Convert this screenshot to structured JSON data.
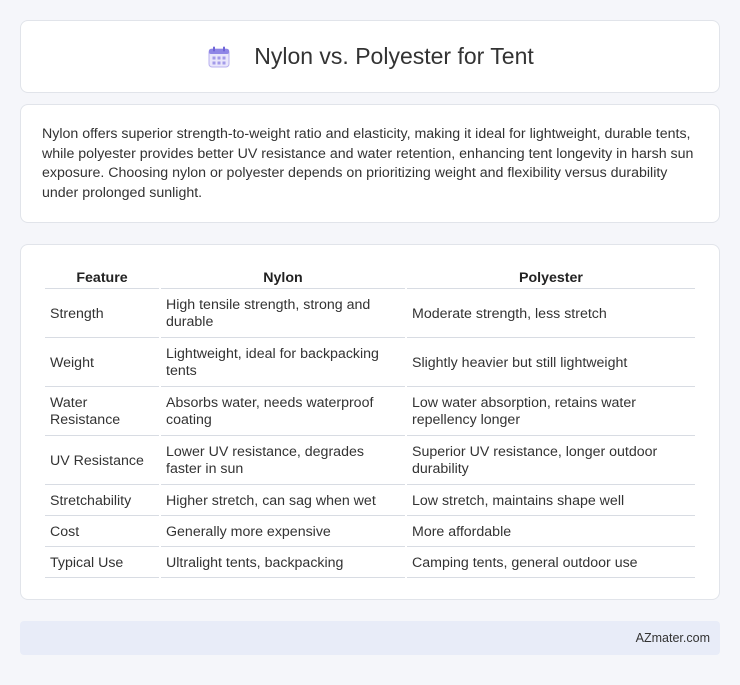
{
  "header": {
    "title": "Nylon vs. Polyester for Tent",
    "icon": "calendar-icon"
  },
  "summary": "Nylon offers superior strength-to-weight ratio and elasticity, making it ideal for lightweight, durable tents, while polyester provides better UV resistance and water retention, enhancing tent longevity in harsh sun exposure. Choosing nylon or polyester depends on prioritizing weight and flexibility versus durability under prolonged sunlight.",
  "table": {
    "headers": [
      "Feature",
      "Nylon",
      "Polyester"
    ],
    "rows": [
      [
        "Strength",
        "High tensile strength, strong and durable",
        "Moderate strength, less stretch"
      ],
      [
        "Weight",
        "Lightweight, ideal for backpacking tents",
        "Slightly heavier but still lightweight"
      ],
      [
        "Water Resistance",
        "Absorbs water, needs waterproof coating",
        "Low water absorption, retains water repellency longer"
      ],
      [
        "UV Resistance",
        "Lower UV resistance, degrades faster in sun",
        "Superior UV resistance, longer outdoor durability"
      ],
      [
        "Stretchability",
        "Higher stretch, can sag when wet",
        "Low stretch, maintains shape well"
      ],
      [
        "Cost",
        "Generally more expensive",
        "More affordable"
      ],
      [
        "Typical Use",
        "Ultralight tents, backpacking",
        "Camping tents, general outdoor use"
      ]
    ]
  },
  "footer": {
    "brand": "AZmater.com"
  }
}
